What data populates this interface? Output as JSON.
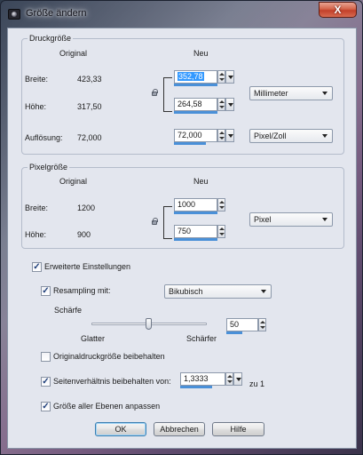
{
  "window": {
    "title": "Größe ändern",
    "close_label": "X"
  },
  "print_size": {
    "group_title": "Druckgröße",
    "col_original": "Original",
    "col_new": "Neu",
    "width_label": "Breite:",
    "width_original": "423,33",
    "width_new_value": "352,78",
    "height_label": "Höhe:",
    "height_original": "317,50",
    "height_new_value": "264,58",
    "unit_select": "Millimeter",
    "resolution_label": "Auflösung:",
    "resolution_original": "72,000",
    "resolution_new_value": "72,000",
    "resolution_unit_select": "Pixel/Zoll"
  },
  "pixel_size": {
    "group_title": "Pixelgröße",
    "col_original": "Original",
    "col_new": "Neu",
    "width_label": "Breite:",
    "width_original": "1200",
    "width_new_value": "1000",
    "height_label": "Höhe:",
    "height_original": "900",
    "height_new_value": "750",
    "unit_select": "Pixel"
  },
  "advanced": {
    "advanced_label": "Erweiterte Einstellungen",
    "advanced_checked": true,
    "resampling_label": "Resampling mit:",
    "resampling_checked": true,
    "resampling_select": "Bikubisch",
    "sharpness_label": "Schärfe",
    "sharpness_min_label": "Glatter",
    "sharpness_max_label": "Schärfer",
    "sharpness_value": "50",
    "sharpness_level": 0.5,
    "keep_print_size_label": "Originaldruckgröße beibehalten",
    "keep_print_size_checked": false,
    "keep_ratio_label": "Seitenverhältnis beibehalten von:",
    "keep_ratio_checked": true,
    "ratio_value": "1,3333",
    "ratio_suffix": "zu 1",
    "resize_all_layers_label": "Größe aller Ebenen anpassen",
    "resize_all_layers_checked": true
  },
  "buttons": {
    "ok": "OK",
    "cancel": "Abbrechen",
    "help": "Hilfe"
  },
  "icons": {
    "app": "app-icon",
    "lock": "lock-icon",
    "spin_up": "arrow-up-icon",
    "spin_down": "arrow-down-icon",
    "dropdown": "chevron-down-icon"
  }
}
